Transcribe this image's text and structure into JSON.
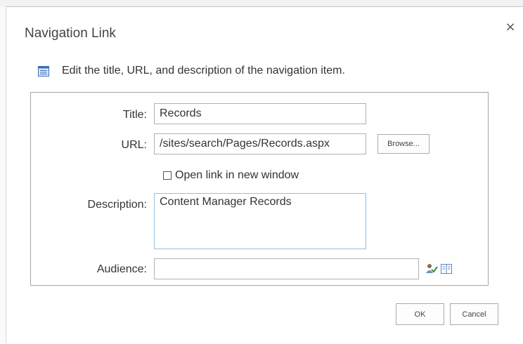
{
  "dialog": {
    "title": "Navigation Link",
    "close_symbol": "×",
    "instruction": "Edit the title, URL, and description of the navigation item."
  },
  "form": {
    "title_label": "Title:",
    "title_value": "Records",
    "url_label": "URL:",
    "url_value": "/sites/search/Pages/Records.aspx",
    "browse_label": "Browse...",
    "new_window_label": "Open link in new window",
    "new_window_checked": false,
    "description_label": "Description:",
    "description_value": "Content Manager Records",
    "audience_label": "Audience:",
    "audience_value": ""
  },
  "footer": {
    "ok_label": "OK",
    "cancel_label": "Cancel"
  },
  "icons": {
    "info": "edit-list-icon",
    "audience_check": "check-names-icon",
    "audience_browse": "address-book-icon"
  }
}
